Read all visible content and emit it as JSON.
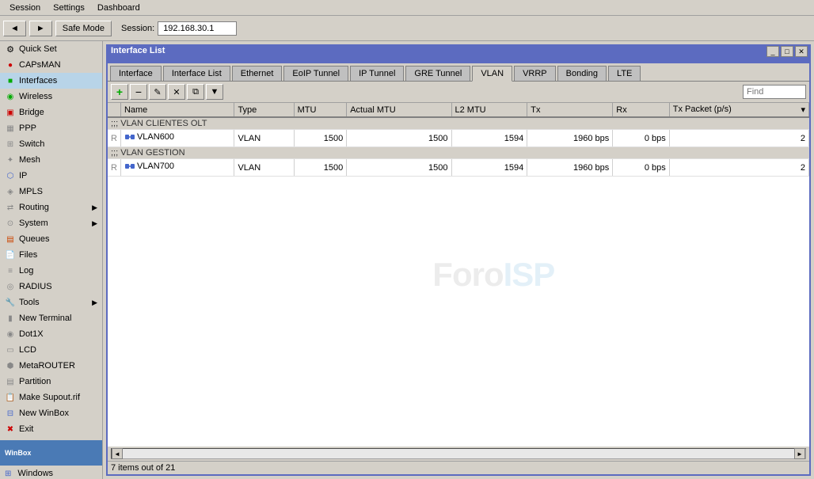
{
  "menu": {
    "items": [
      "Session",
      "Settings",
      "Dashboard"
    ]
  },
  "toolbar": {
    "back_label": "◄",
    "forward_label": "►",
    "safe_mode_label": "Safe Mode",
    "session_label": "Session:",
    "session_ip": "192.168.30.1"
  },
  "sidebar": {
    "items": [
      {
        "label": "Quick Set",
        "icon": "gear",
        "color": "#888"
      },
      {
        "label": "CAPsMAN",
        "icon": "cap",
        "color": "#cc0000"
      },
      {
        "label": "Interfaces",
        "icon": "iface",
        "color": "#00aa00"
      },
      {
        "label": "Wireless",
        "icon": "wireless",
        "color": "#00aa00"
      },
      {
        "label": "Bridge",
        "icon": "bridge",
        "color": "#cc0000"
      },
      {
        "label": "PPP",
        "icon": "ppp",
        "color": "#888"
      },
      {
        "label": "Switch",
        "icon": "switch",
        "color": "#888"
      },
      {
        "label": "Mesh",
        "icon": "mesh",
        "color": "#888"
      },
      {
        "label": "IP",
        "icon": "ip",
        "color": "#4466cc"
      },
      {
        "label": "MPLS",
        "icon": "mpls",
        "color": "#888"
      },
      {
        "label": "Routing",
        "icon": "routing",
        "color": "#888",
        "has_arrow": true
      },
      {
        "label": "System",
        "icon": "system",
        "color": "#888",
        "has_arrow": true
      },
      {
        "label": "Queues",
        "icon": "queues",
        "color": "#cc4400"
      },
      {
        "label": "Files",
        "icon": "files",
        "color": "#888"
      },
      {
        "label": "Log",
        "icon": "log",
        "color": "#888"
      },
      {
        "label": "RADIUS",
        "icon": "radius",
        "color": "#888"
      },
      {
        "label": "Tools",
        "icon": "tools",
        "color": "#cc0000",
        "has_arrow": true
      },
      {
        "label": "New Terminal",
        "icon": "terminal",
        "color": "#888"
      },
      {
        "label": "Dot1X",
        "icon": "dot1x",
        "color": "#888"
      },
      {
        "label": "LCD",
        "icon": "lcd",
        "color": "#888"
      },
      {
        "label": "MetaROUTER",
        "icon": "metarouter",
        "color": "#888"
      },
      {
        "label": "Partition",
        "icon": "partition",
        "color": "#888"
      },
      {
        "label": "Make Supout.rif",
        "icon": "supout",
        "color": "#888"
      },
      {
        "label": "New WinBox",
        "icon": "winbox",
        "color": "#4466cc"
      },
      {
        "label": "Exit",
        "icon": "exit",
        "color": "#cc0000"
      }
    ],
    "windows_label": "Windows"
  },
  "window": {
    "title": "Interface List",
    "tabs": [
      {
        "label": "Interface"
      },
      {
        "label": "Interface List"
      },
      {
        "label": "Ethernet"
      },
      {
        "label": "EoIP Tunnel"
      },
      {
        "label": "IP Tunnel"
      },
      {
        "label": "GRE Tunnel"
      },
      {
        "label": "VLAN",
        "active": true
      },
      {
        "label": "VRRP"
      },
      {
        "label": "Bonding"
      },
      {
        "label": "LTE"
      }
    ],
    "toolbar": {
      "add": "+",
      "remove": "−",
      "edit": "✎",
      "delete": "✕",
      "copy": "⧉",
      "filter": "▼",
      "find_placeholder": "Find"
    },
    "columns": [
      {
        "label": "",
        "width": 16
      },
      {
        "label": "Name",
        "width": 160
      },
      {
        "label": "Type",
        "width": 100
      },
      {
        "label": "MTU",
        "width": 50
      },
      {
        "label": "Actual MTU",
        "width": 80
      },
      {
        "label": "L2 MTU",
        "width": 60
      },
      {
        "label": "Tx",
        "width": 120
      },
      {
        "label": "Rx",
        "width": 120
      },
      {
        "label": "Tx Packet (p/s)",
        "width": 120
      }
    ],
    "sections": [
      {
        "header": ";;; VLAN CLIENTES OLT",
        "rows": [
          {
            "flag": "R",
            "name": "VLAN600",
            "type": "VLAN",
            "mtu": "1500",
            "actual_mtu": "1500",
            "l2_mtu": "1594",
            "tx": "1960 bps",
            "rx": "0 bps",
            "tx_pkt": "2"
          }
        ]
      },
      {
        "header": ";;; VLAN GESTION",
        "rows": [
          {
            "flag": "R",
            "name": "VLAN700",
            "type": "VLAN",
            "mtu": "1500",
            "actual_mtu": "1500",
            "l2_mtu": "1594",
            "tx": "1960 bps",
            "rx": "0 bps",
            "tx_pkt": "2"
          }
        ]
      }
    ],
    "watermark": "ForoISP",
    "status": "7 items out of 21"
  }
}
